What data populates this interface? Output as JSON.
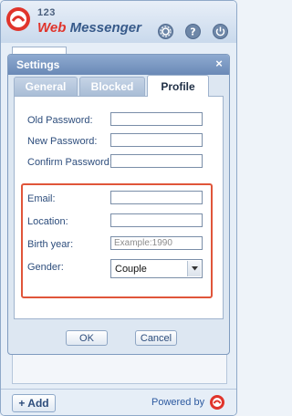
{
  "app": {
    "logo_small": "123",
    "logo_name_part1": "Web",
    "logo_name_part2": "Messenger",
    "icons": [
      "gear-icon",
      "help-icon",
      "power-icon"
    ]
  },
  "footer": {
    "add_label": "+ Add",
    "powered_by": "Powered by"
  },
  "dialog": {
    "title": "Settings",
    "close_glyph": "×",
    "tabs": [
      {
        "label": "General",
        "active": false
      },
      {
        "label": "Blocked",
        "active": false
      },
      {
        "label": "Profile",
        "active": true
      }
    ],
    "password_fields": [
      {
        "label": "Old Password:",
        "value": ""
      },
      {
        "label": "New Password:",
        "value": ""
      },
      {
        "label": "Confirm Password:",
        "value": ""
      }
    ],
    "profile_fields": {
      "email": {
        "label": "Email:",
        "value": ""
      },
      "location": {
        "label": "Location:",
        "value": ""
      },
      "birth_year": {
        "label": "Birth year:",
        "value": "",
        "placeholder": "Example:1990"
      },
      "gender": {
        "label": "Gender:",
        "selected": "Couple"
      }
    },
    "highlight_color": "#e0553a",
    "buttons": {
      "ok": "OK",
      "cancel": "Cancel"
    }
  }
}
